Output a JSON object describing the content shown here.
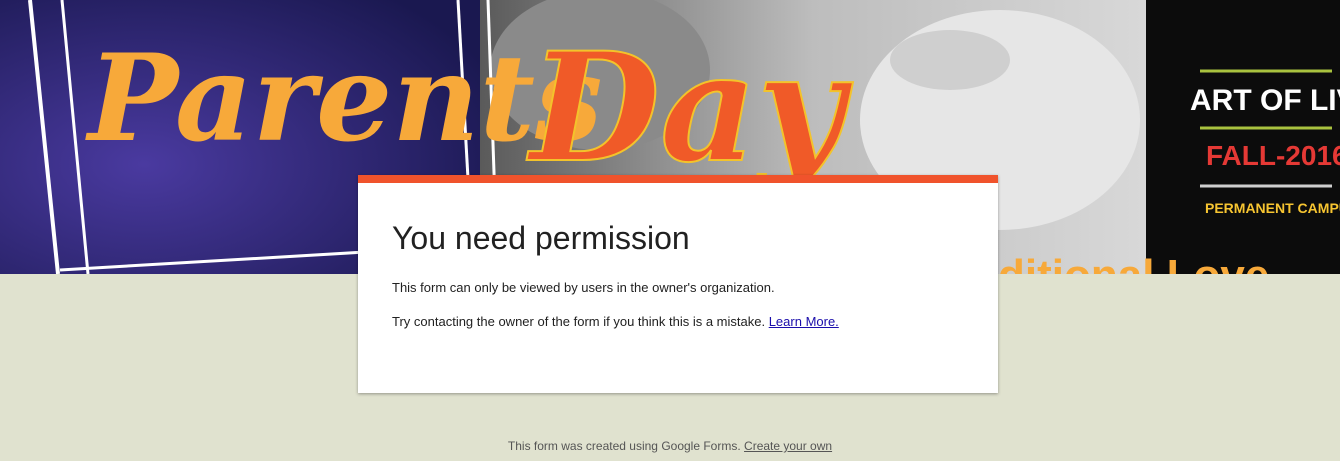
{
  "banner": {
    "word_parents": "Parents",
    "word_day": "Day",
    "brand_title": "ART OF LIVING",
    "brand_term": "FALL-2016",
    "brand_sub": "PERMANENT CAMPUS",
    "partial_text": "ditional Love"
  },
  "card": {
    "title": "You need permission",
    "line1": "This form can only be viewed by users in the owner's organization.",
    "line2": "Try contacting the owner of the form if you think this is a mistake.",
    "learn_more": "Learn More."
  },
  "footer": {
    "text": "This form was created using Google Forms.",
    "link": "Create your own"
  },
  "colors": {
    "accent": "#f0532c",
    "background": "#e0e2cf",
    "banner_navy": "#1f1c5c",
    "banner_yellow": "#f7a93a"
  }
}
